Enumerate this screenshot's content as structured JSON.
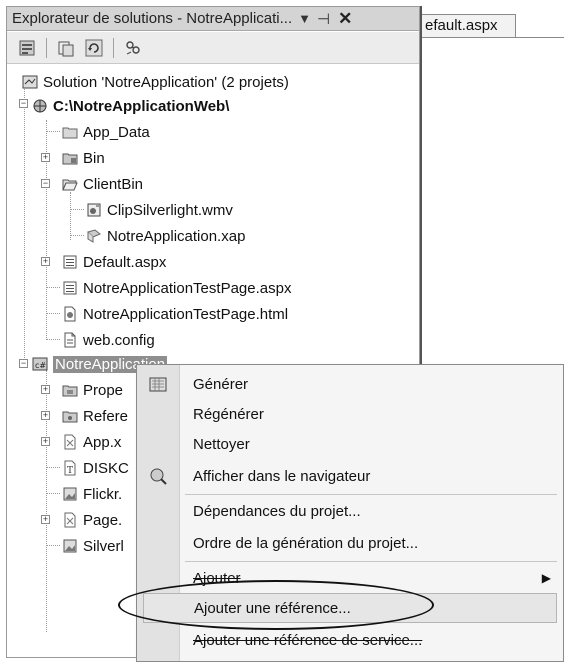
{
  "window": {
    "title": "Explorateur de solutions - NotreApplicati...",
    "dropdown_glyph": "▼",
    "pin_glyph": "⊣",
    "close_glyph": "✕"
  },
  "toolbar": {
    "buttons": [
      "properties-icon",
      "show-all-files-icon",
      "refresh-icon",
      "view-class-diagram-icon"
    ]
  },
  "doc_tab": {
    "label": "efault.aspx"
  },
  "tree": {
    "solution": "Solution 'NotreApplication' (2 projets)",
    "web_project": "C:\\NotreApplicationWeb\\",
    "items_web": {
      "app_data": "App_Data",
      "bin": "Bin",
      "clientbin": "ClientBin",
      "wmv": "ClipSilverlight.wmv",
      "xap": "NotreApplication.xap",
      "default": "Default.aspx",
      "test_aspx": "NotreApplicationTestPage.aspx",
      "test_html": "NotreApplicationTestPage.html",
      "webconfig": "web.config"
    },
    "sl_project": "NotreApplication",
    "items_sl": {
      "props": "Prope",
      "refs": "Refere",
      "appx": "App.x",
      "disk": "DISKC",
      "flickr": "Flickr.",
      "page": "Page.",
      "silver": "Silverl"
    }
  },
  "context_menu": {
    "generer": "Générer",
    "regenerer": "Régénérer",
    "nettoyer": "Nettoyer",
    "afficher": "Afficher dans le navigateur",
    "dependances": "Dépendances du projet...",
    "ordre": "Ordre de la génération du projet...",
    "ajouter": "Ajouter",
    "ajouter_ref": "Ajouter une référence...",
    "ajouter_ref_service": "Ajouter une référence de service...",
    "submenu_arrow": "▶"
  }
}
